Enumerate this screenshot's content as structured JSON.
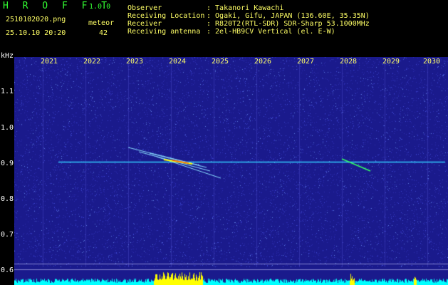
{
  "header": {
    "app_name": "H R O F F T",
    "version": "1.0.0",
    "filename": "2510102020.png",
    "datetime": "25.10.10 20:20",
    "detection_label": "meteor",
    "detection_count": "42",
    "info": [
      {
        "label": "Observer",
        "value": ": Takanori Kawachi"
      },
      {
        "label": "Receiving Location",
        "value": ": Ogaki, Gifu, JAPAN (136.60E, 35.35N)"
      },
      {
        "label": "Receiver",
        "value": ": R820T2(RTL-SDR) SDR-Sharp 53.1000MHz"
      },
      {
        "label": "Receiving antenna",
        "value": ": 2el-HB9CV Vertical (el. E-W)"
      }
    ]
  },
  "spectrogram": {
    "y_unit": "kHz",
    "y_ticks": [
      "1.1",
      "1.0",
      "0.9",
      "0.8",
      "0.7",
      "0.6"
    ],
    "x_ticks": [
      "2021",
      "2022",
      "2023",
      "2024",
      "2025",
      "2026",
      "2027",
      "2028",
      "2029",
      "2030"
    ],
    "colors": {
      "background": "#1a1a8c",
      "carrier": "#33ccff",
      "echo": "#ffff00",
      "activity": "#00ffff"
    }
  }
}
